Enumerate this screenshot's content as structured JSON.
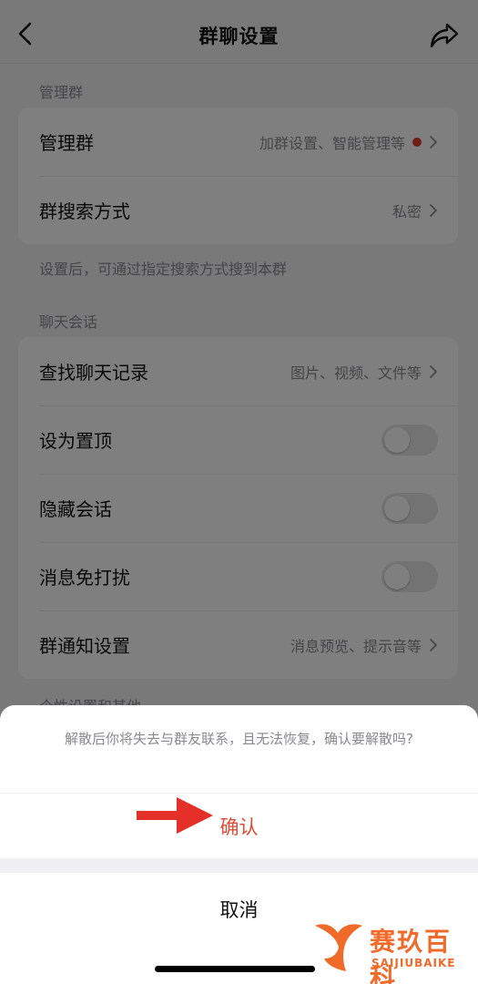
{
  "nav": {
    "title": "群聊设置",
    "back_icon": "chevron-left-icon",
    "share_icon": "share-icon"
  },
  "sections": {
    "manage_label": "管理群",
    "manage": {
      "row1": {
        "title": "管理群",
        "value": "加群设置、智能管理等",
        "has_red_dot": true
      },
      "row2": {
        "title": "群搜索方式",
        "value": "私密"
      }
    },
    "manage_hint": "设置后，可通过指定搜索方式搜到本群",
    "chat_label": "聊天会话",
    "chat": {
      "find_history": {
        "title": "查找聊天记录",
        "value": "图片、视频、文件等"
      },
      "pin": {
        "title": "设为置顶",
        "on": false
      },
      "hide": {
        "title": "隐藏会话",
        "on": false
      },
      "mute": {
        "title": "消息免打扰",
        "on": false
      },
      "notify": {
        "title": "群通知设置",
        "value": "消息预览、提示音等"
      }
    },
    "other_label": "个性设置和其他"
  },
  "sheet": {
    "message": "解散后你将失去与群友联系，且无法恢复，确认要解散吗?",
    "confirm_label": "确认",
    "cancel_label": "取消"
  },
  "annotation": {
    "arrow_color": "#e5302a"
  },
  "watermark": {
    "cn": "赛玖百科",
    "en": "SAIJIUBAIKE"
  },
  "colors": {
    "accent_red": "#e24c36",
    "background": "#f2f2f4",
    "secondary_text": "#8a8a8e"
  }
}
